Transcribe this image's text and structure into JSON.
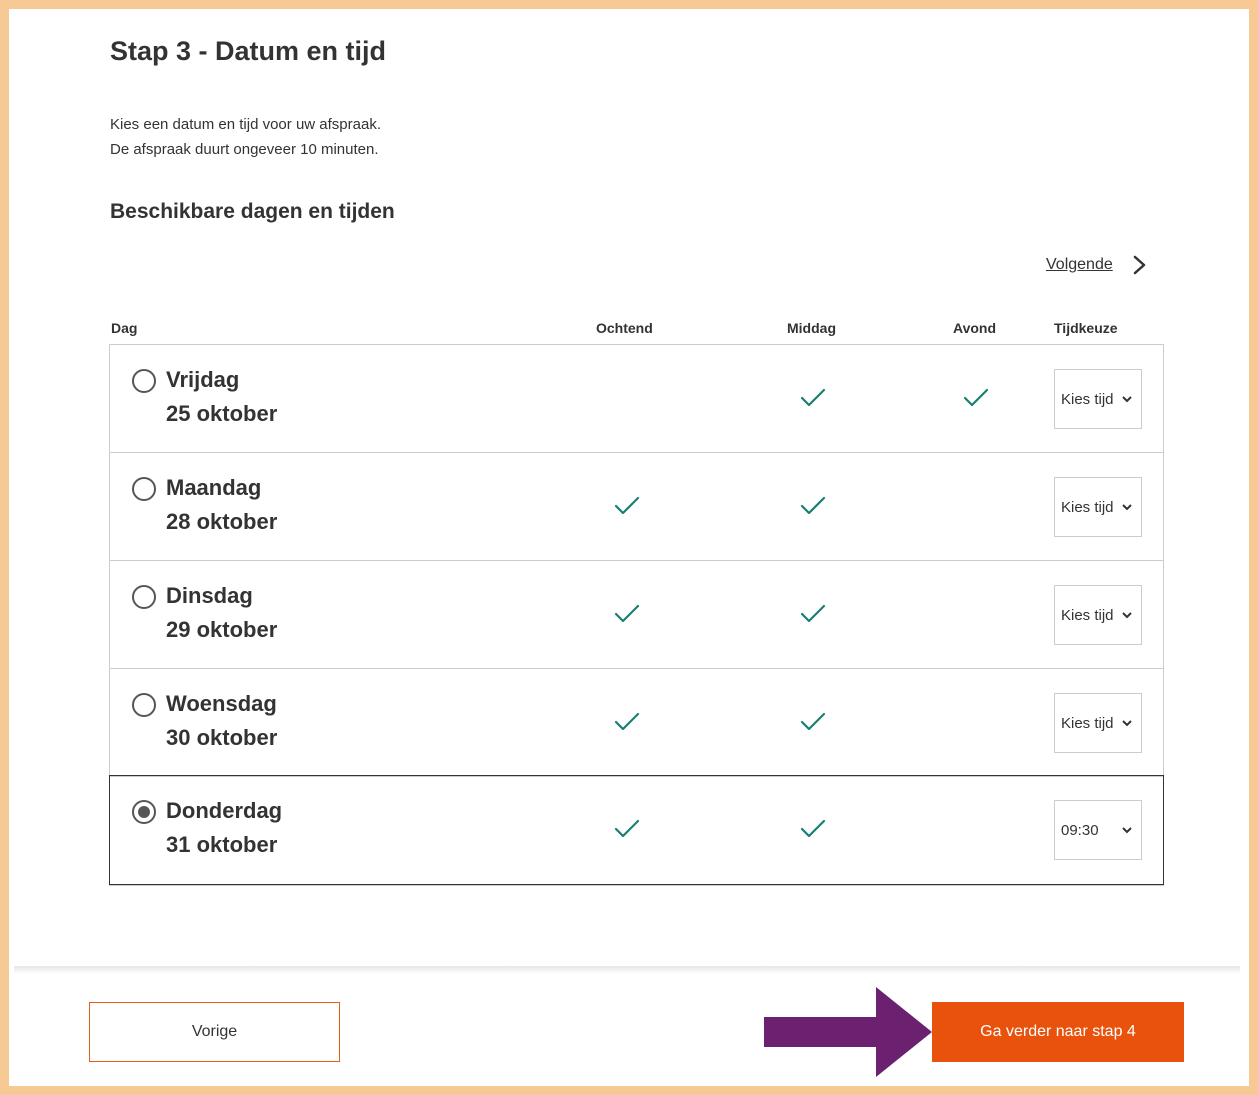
{
  "page": {
    "title": "Stap 3 - Datum en tijd",
    "intro_line1": "Kies een datum en tijd voor uw afspraak.",
    "intro_line2": "De afspraak duurt ongeveer 10 minuten.",
    "subtitle": "Beschikbare dagen en tijden",
    "next_link": "Volgende"
  },
  "table": {
    "headers": {
      "day": "Dag",
      "morning": "Ochtend",
      "afternoon": "Middag",
      "evening": "Avond",
      "time": "Tijdkeuze"
    },
    "rows": [
      {
        "day": "Vrijdag",
        "date": "25 oktober",
        "selected": false,
        "morning": false,
        "afternoon": true,
        "evening": true,
        "time": "Kies tijd"
      },
      {
        "day": "Maandag",
        "date": "28 oktober",
        "selected": false,
        "morning": true,
        "afternoon": true,
        "evening": false,
        "time": "Kies tijd"
      },
      {
        "day": "Dinsdag",
        "date": "29 oktober",
        "selected": false,
        "morning": true,
        "afternoon": true,
        "evening": false,
        "time": "Kies tijd"
      },
      {
        "day": "Woensdag",
        "date": "30 oktober",
        "selected": false,
        "morning": true,
        "afternoon": true,
        "evening": false,
        "time": "Kies tijd"
      },
      {
        "day": "Donderdag",
        "date": "31 oktober",
        "selected": true,
        "morning": true,
        "afternoon": true,
        "evening": false,
        "time": "09:30"
      }
    ]
  },
  "footer": {
    "prev_label": "Vorige",
    "next_label": "Ga verder naar stap 4"
  },
  "colors": {
    "accent": "#e8520c",
    "check": "#1a7f72",
    "frame": "#f7c995",
    "arrow": "#6b2070"
  },
  "icons": [
    "chevron-right-icon",
    "check-icon",
    "chevron-down-icon",
    "arrow-right-icon"
  ]
}
